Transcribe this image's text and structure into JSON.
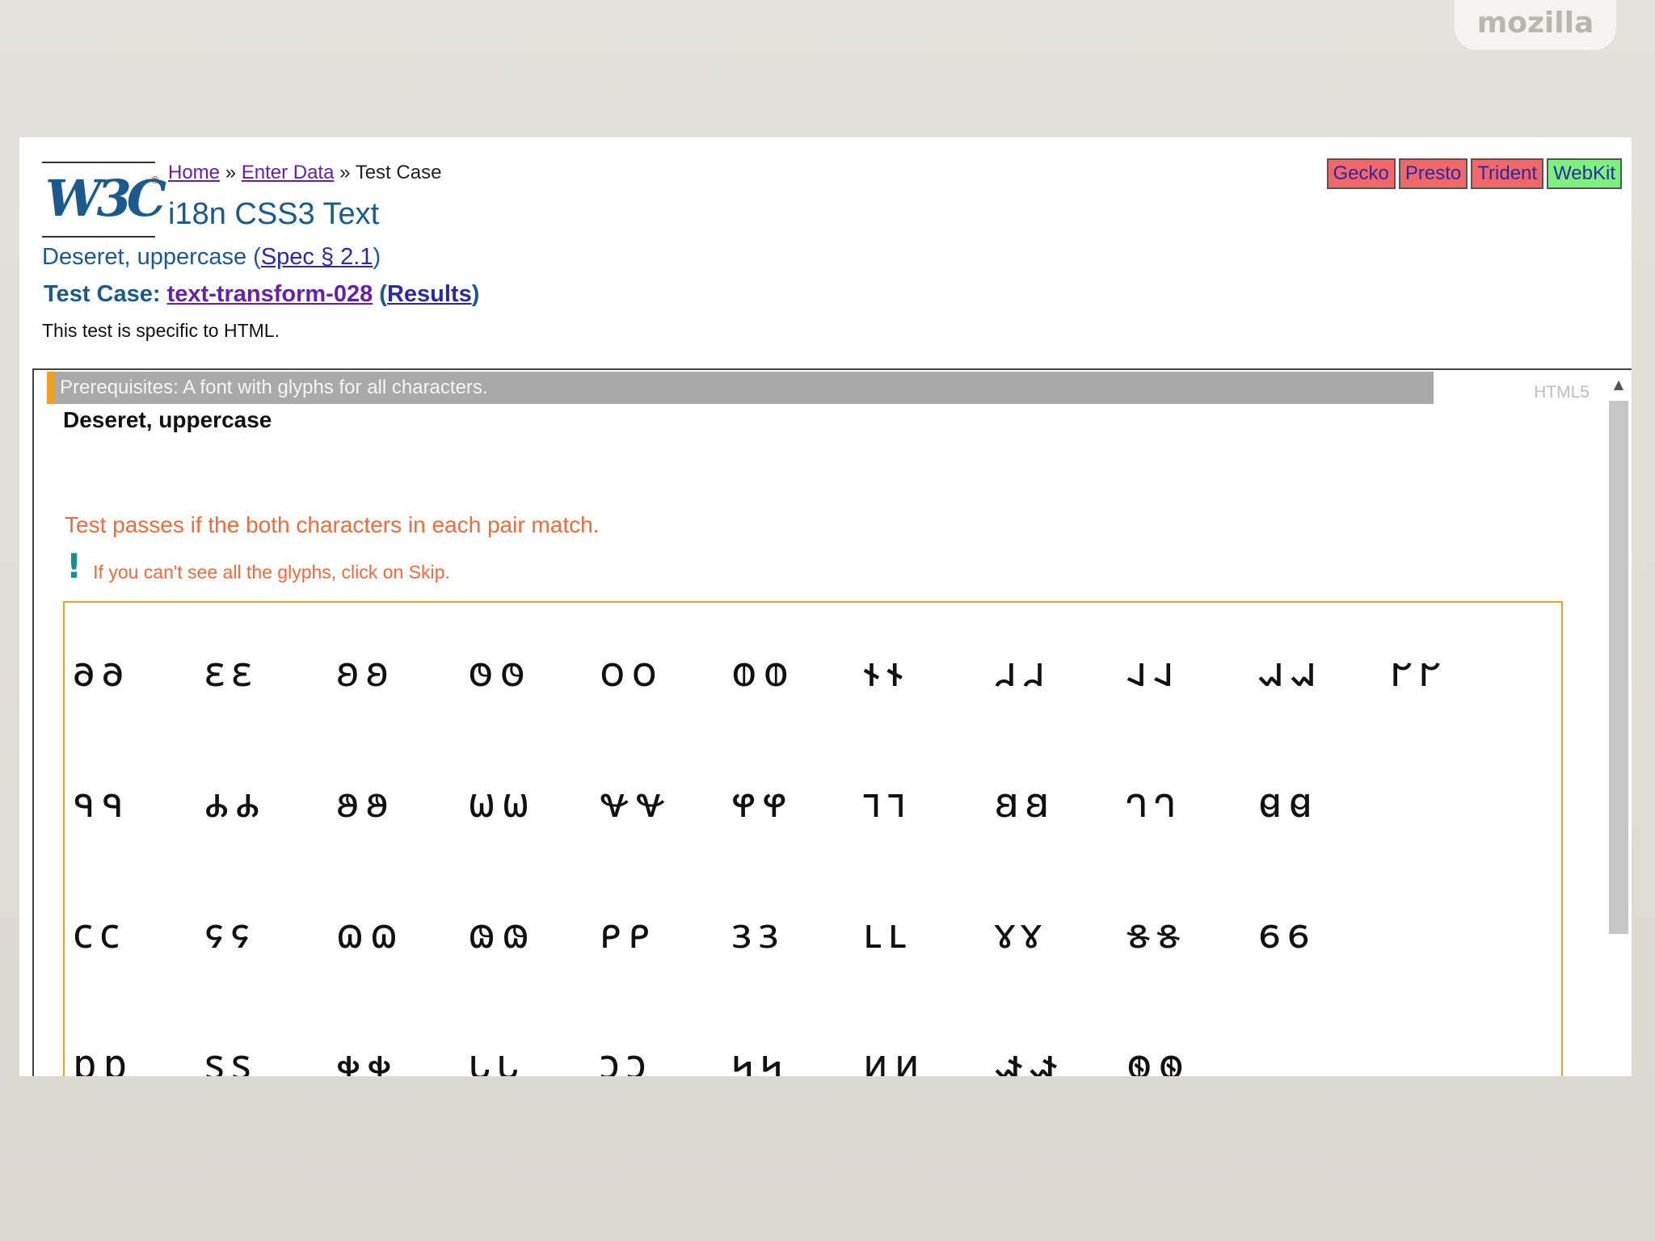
{
  "slide": {
    "brand": "mozilla"
  },
  "header": {
    "breadcrumb": {
      "home": "Home",
      "sep1": " » ",
      "enter_data": "Enter Data",
      "sep2": " » ",
      "current": "Test Case"
    },
    "site_title": "i18n CSS3 Text",
    "subtitle": {
      "text": "Deseret, uppercase",
      "open": " (",
      "spec_link": "Spec § 2.1",
      "close": ")"
    },
    "testcase": {
      "label": "Test Case: ",
      "id": "text-transform-028",
      "open": " (",
      "results": "Results",
      "close": ")"
    },
    "note": "This test is specific to HTML.",
    "engines": [
      {
        "label": "Gecko",
        "status": "fail"
      },
      {
        "label": "Presto",
        "status": "fail"
      },
      {
        "label": "Trident",
        "status": "fail"
      },
      {
        "label": "WebKit",
        "status": "pass"
      }
    ]
  },
  "test_frame": {
    "prerequisites": "Prerequisites: A font with glyphs for all characters.",
    "format": "HTML5",
    "title": "Deseret, uppercase",
    "assertion": "Test passes if the both characters in each pair match.",
    "skip_note": "If you can't see all the glyphs, click on Skip.",
    "glyph_rows": [
      [
        "𐐨𐐨",
        "𐐩𐐩",
        "𐐪𐐪",
        "𐐫𐐫",
        "𐐬𐐬",
        "𐐭𐐭",
        "𐐮𐐮",
        "𐐯𐐯",
        "𐐰𐐰",
        "𐐱𐐱",
        "𐐲𐐲"
      ],
      [
        "𐐳𐐳",
        "𐐴𐐴",
        "𐐵𐐵",
        "𐐶𐐶",
        "𐐷𐐷",
        "𐐸𐐸",
        "𐐹𐐹",
        "𐐺𐐺",
        "𐐻𐐻",
        "𐐼𐐼"
      ],
      [
        "𐐽𐐽",
        "𐐾𐐾",
        "𐐿𐐿",
        "𐑀𐑀",
        "𐑁𐑁",
        "𐑂𐑂",
        "𐑃𐑃",
        "𐑄𐑄",
        "𐑅𐑅",
        "𐑆𐑆"
      ],
      [
        "𐑇𐑇",
        "𐑈𐑈",
        "𐑉𐑉",
        "𐑊𐑊",
        "𐑋𐑋",
        "𐑌𐑌",
        "𐑍𐑍",
        "𐑎𐑎",
        "𐑏𐑏"
      ]
    ]
  }
}
